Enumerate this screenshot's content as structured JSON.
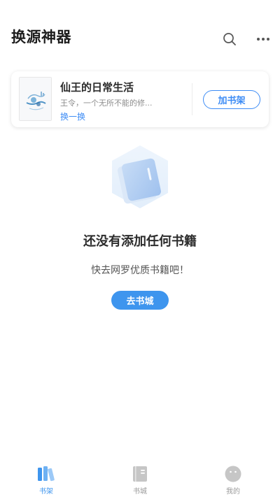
{
  "header": {
    "title": "换源神器",
    "search_icon": "search-icon",
    "more_icon": "more-horizontal-icon"
  },
  "recommend": {
    "book_title": "仙王的日常生活",
    "book_desc": "王令，一个无所不能的修...",
    "switch_label": "换一换",
    "add_button_label": "加书架"
  },
  "empty_state": {
    "title": "还没有添加任何书籍",
    "subtitle": "快去网罗优质书籍吧！",
    "button_label": "去书城"
  },
  "bottom_nav": {
    "items": [
      {
        "label": "书架",
        "icon": "bookshelf-icon",
        "active": true
      },
      {
        "label": "书城",
        "icon": "bookstore-icon",
        "active": false
      },
      {
        "label": "我的",
        "icon": "profile-face-icon",
        "active": false
      }
    ]
  },
  "colors": {
    "accent": "#3e95ee",
    "inactive": "#c6c6c6"
  }
}
